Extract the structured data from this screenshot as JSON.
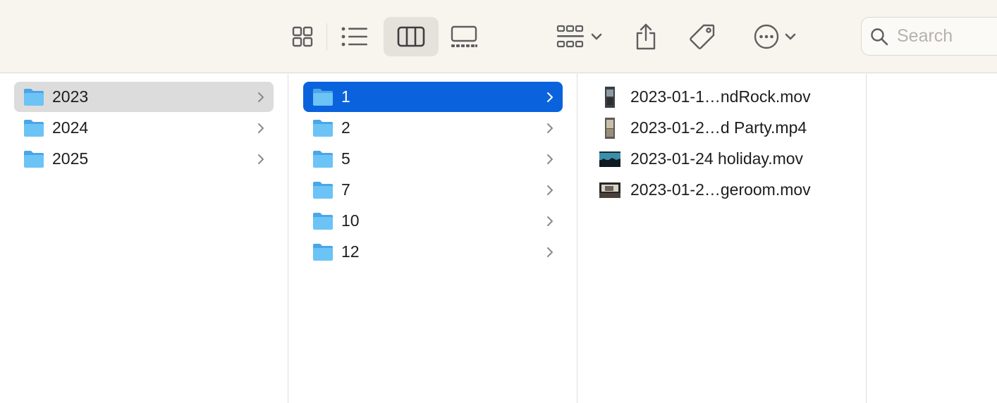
{
  "toolbar": {
    "view_icons": [
      "icon-view-icon",
      "list-view-icon",
      "column-view-icon",
      "gallery-view-icon"
    ],
    "active_view": "column-view",
    "group_icon": "group-by-icon",
    "share_icon": "share-icon",
    "tag_icon": "tag-icon",
    "more_icon": "more-actions-icon",
    "search_placeholder": "Search"
  },
  "columns": {
    "years": [
      {
        "label": "2023",
        "selected": true
      },
      {
        "label": "2024",
        "selected": false
      },
      {
        "label": "2025",
        "selected": false
      }
    ],
    "months": [
      {
        "label": "1",
        "selected": true
      },
      {
        "label": "2",
        "selected": false
      },
      {
        "label": "5",
        "selected": false
      },
      {
        "label": "7",
        "selected": false
      },
      {
        "label": "10",
        "selected": false
      },
      {
        "label": "12",
        "selected": false
      }
    ],
    "files": [
      {
        "label": "2023-01-1…ndRock.mov"
      },
      {
        "label": "2023-01-2…d Party.mp4"
      },
      {
        "label": "2023-01-24 holiday.mov"
      },
      {
        "label": "2023-01-2…geroom.mov"
      }
    ]
  },
  "colors": {
    "toolbar_bg": "#f8f5ef",
    "selection_blue": "#0a63dd",
    "selection_gray": "#dcdcdc",
    "folder_blue": "#5fb9f2"
  }
}
